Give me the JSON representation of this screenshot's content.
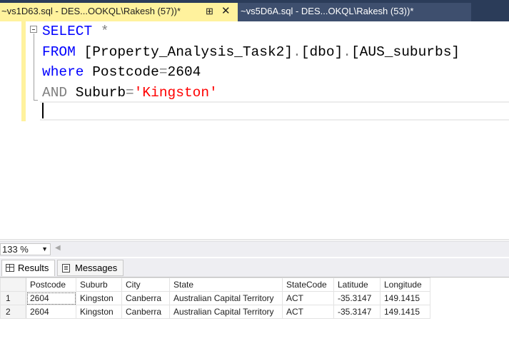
{
  "tabs": [
    {
      "title": "~vs1D63.sql - DES...OOKQL\\Rakesh (57))*",
      "active": true
    },
    {
      "title": "~vs5D6A.sql - DES...OKQL\\Rakesh (53))*",
      "active": false
    }
  ],
  "tab_controls": {
    "pin_glyph": "⊞",
    "close_glyph": "✕"
  },
  "editor": {
    "lines": [
      [
        {
          "t": "SELECT",
          "c": "kw"
        },
        {
          "t": " *",
          "c": "gr"
        }
      ],
      [
        {
          "t": "FROM",
          "c": "kw"
        },
        {
          "t": " [Property_Analysis_Task2]",
          "c": "tx"
        },
        {
          "t": ".",
          "c": "gr"
        },
        {
          "t": "[dbo]",
          "c": "tx"
        },
        {
          "t": ".",
          "c": "gr"
        },
        {
          "t": "[AUS_suburbs]",
          "c": "tx"
        }
      ],
      [
        {
          "t": "where",
          "c": "kw"
        },
        {
          "t": " Postcode",
          "c": "tx"
        },
        {
          "t": "=",
          "c": "gr"
        },
        {
          "t": "2604",
          "c": "tx"
        }
      ],
      [
        {
          "t": "AND",
          "c": "gr"
        },
        {
          "t": " Suburb",
          "c": "tx"
        },
        {
          "t": "=",
          "c": "gr"
        },
        {
          "t": "'Kingston'",
          "c": "str"
        }
      ]
    ]
  },
  "zoom": {
    "value": "133 %"
  },
  "result_tabs": {
    "results": "Results",
    "messages": "Messages"
  },
  "results": {
    "columns": [
      "Postcode",
      "Suburb",
      "City",
      "State",
      "StateCode",
      "Latitude",
      "Longitude"
    ],
    "rows": [
      {
        "num": "1",
        "cells": [
          "2604",
          "Kingston",
          "Canberra",
          "Australian Capital Territory",
          "ACT",
          "-35.3147",
          "149.1415"
        ]
      },
      {
        "num": "2",
        "cells": [
          "2604",
          "Kingston",
          "Canberra",
          "Australian Capital Territory",
          "ACT",
          "-35.3147",
          "149.1415"
        ]
      }
    ]
  },
  "colors": {
    "tab_active_bg": "#fff29d",
    "tab_bar_bg": "#2b3c59",
    "keyword": "#0000ff",
    "string": "#ff0000",
    "operator": "#808080"
  }
}
